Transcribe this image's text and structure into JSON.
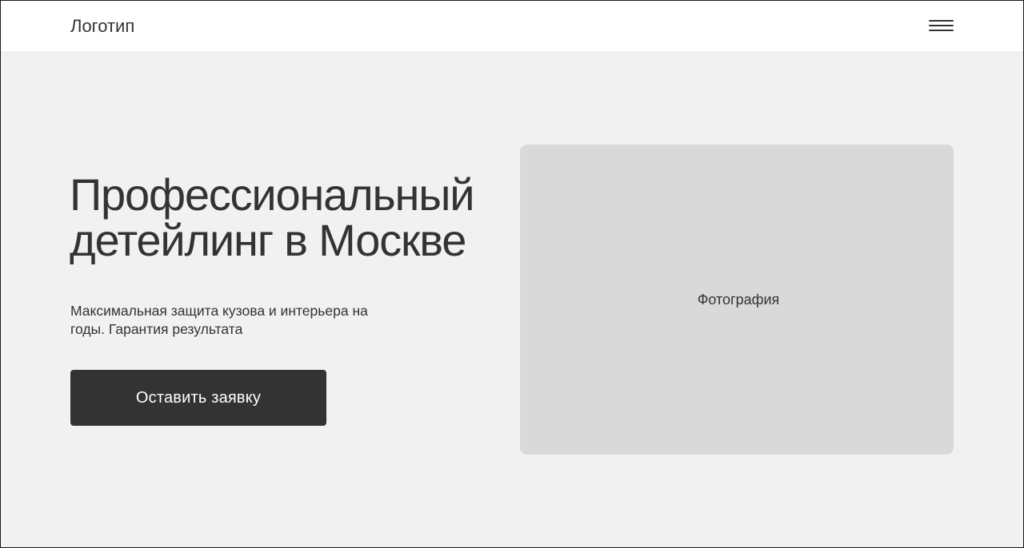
{
  "header": {
    "logo_text": "Логотип",
    "menu_icon": "hamburger-menu-icon"
  },
  "hero": {
    "title": "Профессиональный детейлинг в Москве",
    "subtitle": "Максимальная защита кузова и интерьера на годы. Гарантия результата",
    "cta_label": "Оставить заявку"
  },
  "photo": {
    "placeholder_label": "Фотография"
  },
  "colors": {
    "page_background": "#f1f1f1",
    "header_background": "#ffffff",
    "text": "#333333",
    "button_background": "#333333",
    "button_text": "#ffffff",
    "photo_placeholder": "#d9d9d9"
  }
}
